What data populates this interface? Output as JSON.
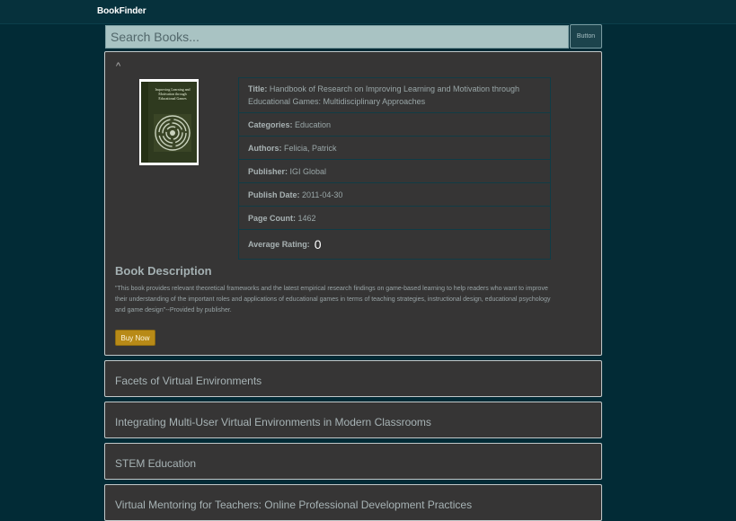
{
  "app": {
    "brand": "BookFinder"
  },
  "search": {
    "placeholder": "Search Books...",
    "button_label": "Button"
  },
  "expanded_book": {
    "toggle": "^",
    "cover_text": "Improving Learning and Motivation through Educational Games",
    "fields": [
      {
        "label": "Title:",
        "value": "Handbook of Research on Improving Learning and Motivation through Educational Games: Multidisciplinary Approaches"
      },
      {
        "label": "Categories:",
        "value": "Education"
      },
      {
        "label": "Authors:",
        "value": "Felicia, Patrick"
      },
      {
        "label": "Publisher:",
        "value": "IGI Global"
      },
      {
        "label": "Publish Date:",
        "value": "2011-04-30"
      },
      {
        "label": "Page Count:",
        "value": "1462"
      },
      {
        "label": "Average Rating:",
        "value": "0"
      }
    ],
    "description_heading": "Book Description",
    "description": "\"This book provides relevant theoretical frameworks and the latest empirical research findings on game-based learning to help readers who want to improve their understanding of the important roles and applications of educational games in terms of teaching strategies, instructional design, educational psychology and game design\"--Provided by publisher.",
    "buy_label": "Buy Now"
  },
  "results": [
    {
      "title": "Facets of Virtual Environments"
    },
    {
      "title": "Integrating Multi-User Virtual Environments in Modern Classrooms"
    },
    {
      "title": "STEM Education"
    },
    {
      "title": "Virtual Mentoring for Teachers: Online Professional Development Practices"
    }
  ],
  "colors": {
    "background": "#022b36",
    "card": "#363535",
    "accent_button": "#b88a17",
    "search_field": "#a9c3c3"
  }
}
